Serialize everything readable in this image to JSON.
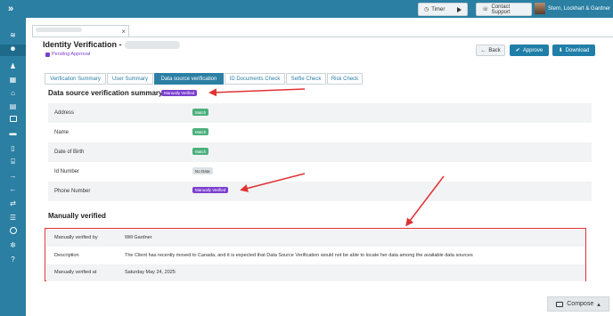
{
  "topbar": {
    "timer_label": "Timer",
    "support_label": "Contact Support",
    "firm_name": "Stern, Lockhart & Gardner"
  },
  "search_tab": {
    "close": "×"
  },
  "page": {
    "title": "Identity Verification -",
    "status": "Pending Approval",
    "buttons": {
      "back": "Back",
      "approve": "Approve",
      "download": "Download"
    }
  },
  "tabs": [
    "Verification Summary",
    "User Summary",
    "Data source verification",
    "ID Documents Check",
    "Selfie Check",
    "Risk Check"
  ],
  "summary": {
    "title": "Data source verification summary",
    "badge": "Manually Verified",
    "rows": [
      {
        "label": "Address",
        "status": "Match"
      },
      {
        "label": "Name",
        "status": "Match"
      },
      {
        "label": "Date of Birth",
        "status": "Match"
      },
      {
        "label": "Id Number",
        "status": "No Data"
      },
      {
        "label": "Phone Number",
        "status": "Manually Verified"
      }
    ]
  },
  "manual": {
    "title": "Manually verified",
    "rows": [
      {
        "key": "Manually verified by",
        "value": "Will Gardner"
      },
      {
        "key": "Description",
        "value": "The Client has recently moved to Canada, and it is expected that Data Source Verification would not be able to locate her data among the available data sources"
      },
      {
        "key": "Manually verified at",
        "value": "Saturday May 24, 2025"
      }
    ]
  },
  "compose_label": "Compose",
  "colors": {
    "primary": "#2a7fa3",
    "purple": "#7b3fcf",
    "match": "#4caf7d",
    "annotation": "#e03333"
  }
}
